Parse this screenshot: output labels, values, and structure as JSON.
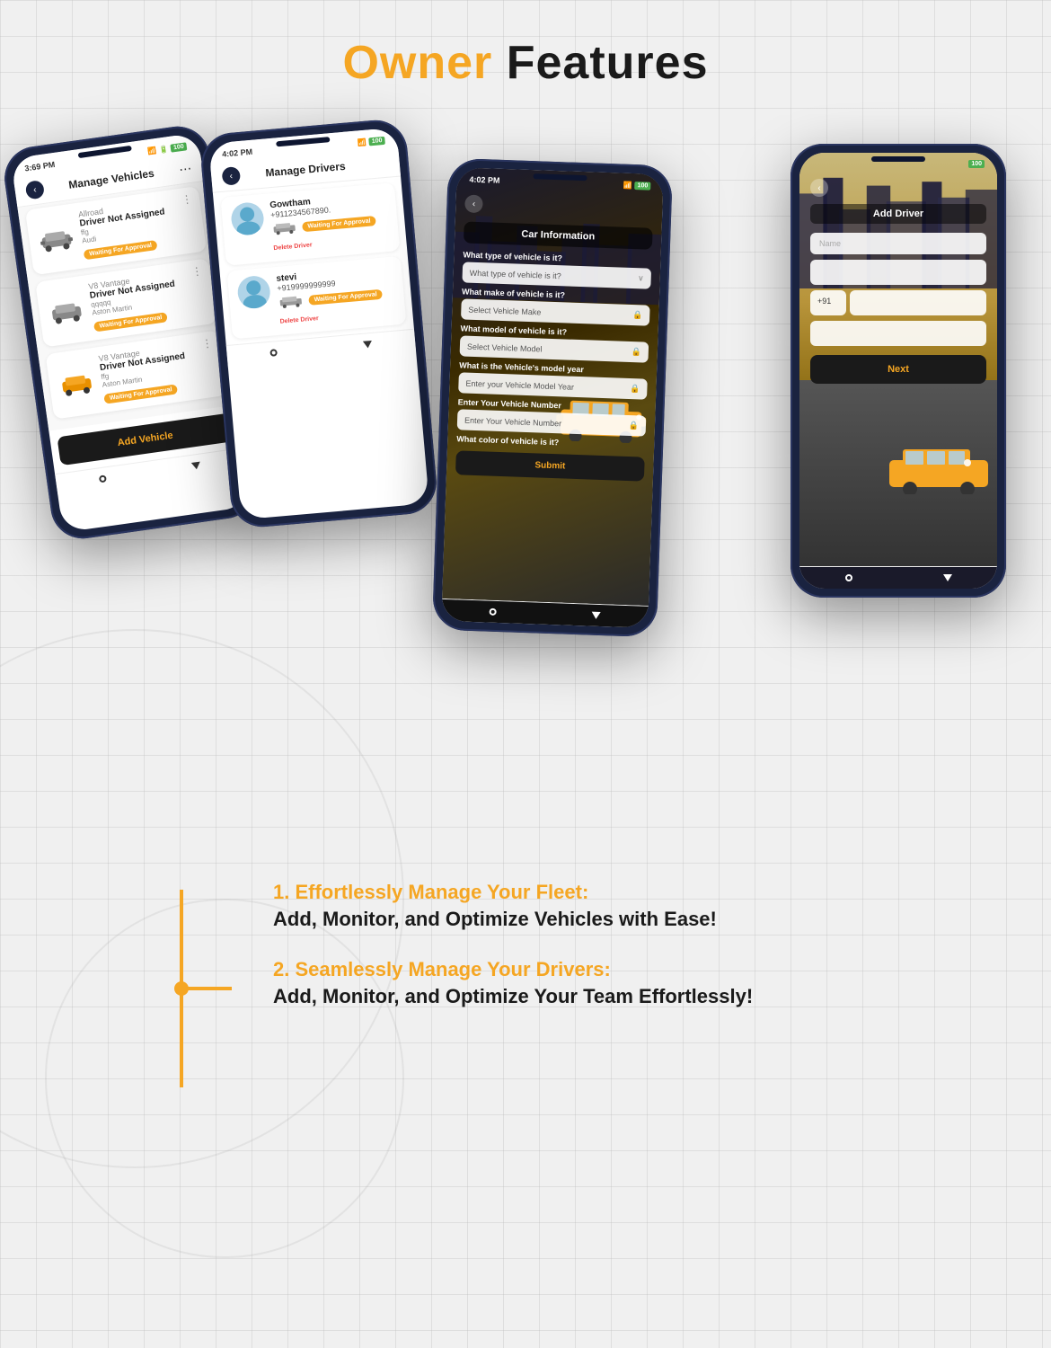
{
  "header": {
    "title_orange": "Owner",
    "title_black": " Features"
  },
  "phone1": {
    "status_time": "3:69 PM",
    "screen_title": "Manage Vehicles",
    "vehicles": [
      {
        "model_name": "Allroad",
        "status": "Driver Not Assigned",
        "sub_name": "ffg",
        "make": "Audi",
        "badge": "Waiting For Approval"
      },
      {
        "model_name": "V8 Vantage",
        "status": "Driver Not Assigned",
        "sub_name": "qqqqq",
        "make": "Aston Martin",
        "badge": "Waiting For Approval"
      },
      {
        "model_name": "V8 Vantage",
        "status": "Driver Not Assigned",
        "sub_name": "ffg",
        "make": "Aston Martin",
        "badge": "Waiting For Approval"
      }
    ],
    "add_vehicle_btn": "Add Vehicle"
  },
  "phone2": {
    "status_time": "4:02 PM",
    "screen_title": "Manage Drivers",
    "drivers": [
      {
        "name": "Gowtham",
        "phone": "+911234567890.",
        "badge": "Waiting For Approval",
        "delete_label": "Delete Driver"
      },
      {
        "name": "stevi",
        "phone": "+919999999999",
        "badge": "Waiting For Approval",
        "delete_label": "Delete Driver"
      }
    ]
  },
  "phone3": {
    "status_time": "4:02 PM",
    "screen_title": "Car Information",
    "fields": {
      "vehicle_type_label": "What type of vehicle is it?",
      "vehicle_type_placeholder": "What type of vehicle is it?",
      "vehicle_make_label": "What make of vehicle is it?",
      "vehicle_make_placeholder": "Select Vehicle Make",
      "vehicle_model_label": "What model of vehicle is it?",
      "vehicle_model_placeholder": "Select Vehicle Model",
      "model_year_label": "What is the Vehicle's model year",
      "model_year_placeholder": "Enter your Vehicle Model Year",
      "vehicle_number_label": "Enter Your Vehicle Number",
      "vehicle_number_placeholder": "Enter Your Vehicle Number",
      "color_label": "What color of vehicle is it?"
    },
    "submit_btn": "Submit"
  },
  "phone4": {
    "screen_title": "Add Driver",
    "name_placeholder": "Name",
    "phone_prefix": "+91",
    "phone_placeholder": "",
    "extra_input_1": "",
    "extra_input_2": "",
    "next_btn": "Next"
  },
  "features": [
    {
      "title": "1. Effortlessly Manage Your Fleet:",
      "subtitle": "Add, Monitor, and Optimize Vehicles with Ease!"
    },
    {
      "title": "2. Seamlessly Manage Your Drivers:",
      "subtitle": "Add, Monitor, and Optimize Your Team Effortlessly!"
    }
  ]
}
